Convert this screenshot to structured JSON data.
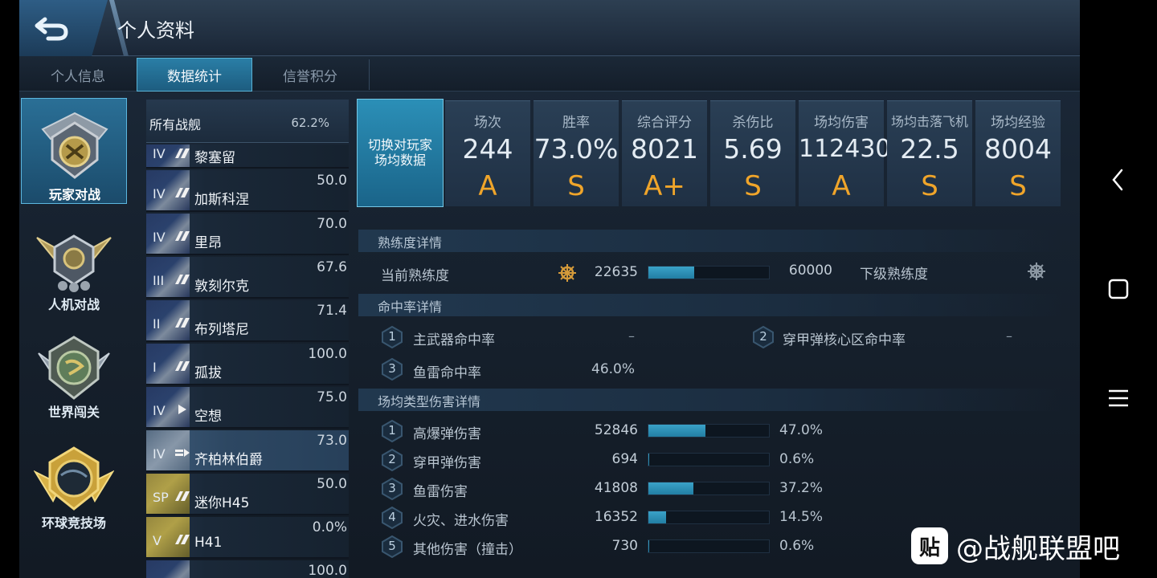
{
  "header": {
    "title": "个人资料"
  },
  "tabs": [
    {
      "label": "个人信息"
    },
    {
      "label": "数据统计"
    },
    {
      "label": "信誉积分"
    }
  ],
  "modes": [
    {
      "label": "玩家对战"
    },
    {
      "label": "人机对战"
    },
    {
      "label": "世界闯关"
    },
    {
      "label": "环球竞技场"
    }
  ],
  "ship_list": {
    "all": {
      "label": "所有战舰",
      "value": "62.2%"
    },
    "ships": [
      {
        "tier": "IV",
        "name": "黎塞留",
        "value": ""
      },
      {
        "tier": "IV",
        "name": "加斯科涅",
        "value": "50.0"
      },
      {
        "tier": "IV",
        "name": "里昂",
        "value": "70.0"
      },
      {
        "tier": "III",
        "name": "敦刻尔克",
        "value": "67.6"
      },
      {
        "tier": "II",
        "name": "布列塔尼",
        "value": "71.4"
      },
      {
        "tier": "I",
        "name": "孤拔",
        "value": "100.0"
      },
      {
        "tier": "IV",
        "name": "空想",
        "value": "75.0"
      },
      {
        "tier": "IV",
        "name": "齐柏林伯爵",
        "value": "73.0"
      },
      {
        "tier": "SP",
        "name": "迷你H45",
        "value": "50.0"
      },
      {
        "tier": "V",
        "name": "H41",
        "value": "0.0%"
      },
      {
        "tier": "",
        "name": "",
        "value": "100.0"
      }
    ]
  },
  "switch_button": {
    "label": "切换对玩家场均数据"
  },
  "stats": [
    {
      "label": "场次",
      "value": "244",
      "grade": "A"
    },
    {
      "label": "胜率",
      "value": "73.0%",
      "grade": "S"
    },
    {
      "label": "综合评分",
      "value": "8021",
      "grade": "A+"
    },
    {
      "label": "杀伤比",
      "value": "5.69",
      "grade": "S"
    },
    {
      "label": "场均伤害",
      "value": "112430",
      "grade": "A"
    },
    {
      "label": "场均击落飞机",
      "value": "22.5",
      "grade": "S"
    },
    {
      "label": "场均经验",
      "value": "8004",
      "grade": "S"
    }
  ],
  "proficiency": {
    "title": "熟练度详情",
    "current_label": "当前熟练度",
    "current_value": "22635",
    "max_value": "60000",
    "progress": 0.377,
    "next_label": "下级熟练度"
  },
  "accuracy": {
    "title": "命中率详情",
    "items": [
      {
        "index": "1",
        "label": "主武器命中率",
        "value": "–"
      },
      {
        "index": "2",
        "label": "穿甲弹核心区命中率",
        "value": "–"
      },
      {
        "index": "3",
        "label": "鱼雷命中率",
        "value": "46.0%"
      }
    ]
  },
  "damage": {
    "title": "场均类型伤害详情",
    "items": [
      {
        "index": "1",
        "label": "高爆弹伤害",
        "value": "52846",
        "pct": "47.0%",
        "ratio": 0.47
      },
      {
        "index": "2",
        "label": "穿甲弹伤害",
        "value": "694",
        "pct": "0.6%",
        "ratio": 0.006
      },
      {
        "index": "3",
        "label": "鱼雷伤害",
        "value": "41808",
        "pct": "37.2%",
        "ratio": 0.372
      },
      {
        "index": "4",
        "label": "火灾、进水伤害",
        "value": "16352",
        "pct": "14.5%",
        "ratio": 0.145
      },
      {
        "index": "5",
        "label": "其他伤害（撞击）",
        "value": "730",
        "pct": "0.6%",
        "ratio": 0.006
      }
    ]
  },
  "colors": {
    "accent": "#2a8fb6",
    "grade": "#f0a52a",
    "bar": "#2f94bb"
  },
  "watermark": {
    "logo": "贴",
    "text": "@战舰联盟吧"
  }
}
